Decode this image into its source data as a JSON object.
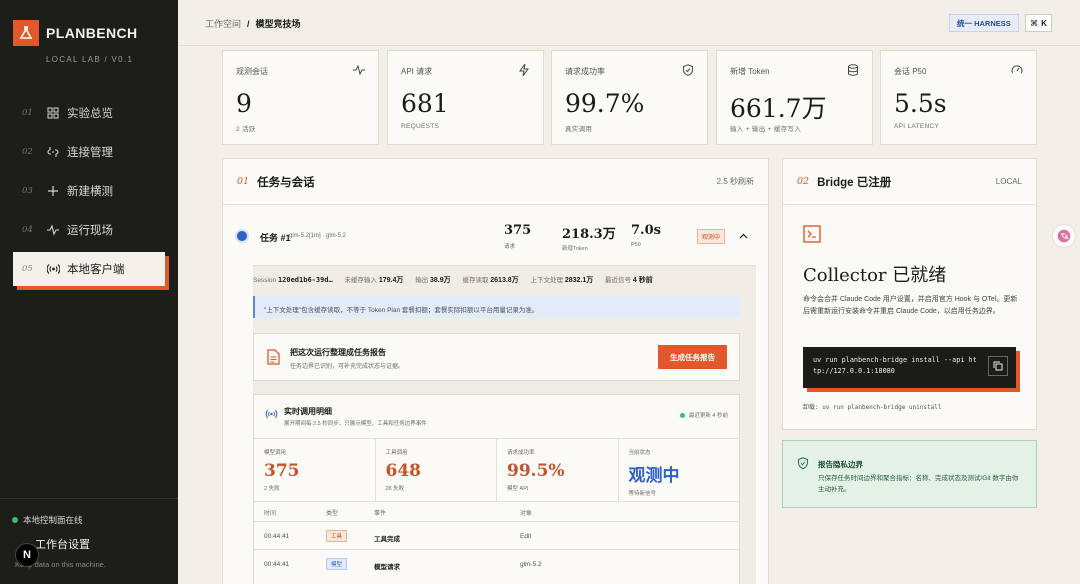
{
  "app": {
    "logo": "PLANBENCH",
    "logo_sub": "LOCAL LAB / V0.1"
  },
  "sidebar": {
    "items": [
      {
        "num": "01",
        "label": "实验总览",
        "icon": "grid-icon"
      },
      {
        "num": "02",
        "label": "连接管理",
        "icon": "plug-icon"
      },
      {
        "num": "03",
        "label": "新建横测",
        "icon": "plus-icon"
      },
      {
        "num": "04",
        "label": "运行现场",
        "icon": "activity-icon"
      },
      {
        "num": "05",
        "label": "本地客户端",
        "icon": "broadcast-icon"
      }
    ],
    "active": 4,
    "status": "本地控制面在线",
    "settings": "工作台设置",
    "settings_note": "Keep data on this machine.",
    "avatar": "N"
  },
  "topbar": {
    "crumb1": "工作空间",
    "sep": "/",
    "crumb2": "模型竞技场",
    "harness": "统一 HARNESS",
    "kbd_key": "K",
    "kbd_mod": "⌘"
  },
  "stats": [
    {
      "label": "观测会话",
      "value": "9",
      "sub": "2 活跃",
      "icon": "pulse-icon"
    },
    {
      "label": "API 请求",
      "value": "681",
      "sub": "REQUESTS",
      "icon": "bolt-icon"
    },
    {
      "label": "请求成功率",
      "value": "99.7%",
      "sub": "真实调用",
      "icon": "shield-icon"
    },
    {
      "label": "新增 Token",
      "value": "661.7万",
      "sub": "输入 + 输出 + 缓存写入",
      "icon": "database-icon"
    },
    {
      "label": "会话 P50",
      "value": "5.5s",
      "sub": "API LATENCY",
      "icon": "gauge-icon"
    }
  ],
  "tasks": {
    "num": "01",
    "title": "任务与会话",
    "refresh": "2.5 秒刷新",
    "task": {
      "name": "任务 #1",
      "model": "glm-5.2[1m] · glm-5.2",
      "requests": "375",
      "requests_label": "请求",
      "tokens": "218.3万",
      "tokens_label": "新增Token",
      "p50": "7.0s",
      "p50_label": "P50",
      "status": "观测中"
    },
    "session": {
      "id_label": "Session",
      "id": "120ed1b6-39d…",
      "in_label": "未缓存输入",
      "in": "179.4万",
      "out_label": "输出",
      "out": "38.9万",
      "cache_label": "缓存读取",
      "cache": "2613.8万",
      "ctx_label": "上下文处理",
      "ctx": "2832.1万",
      "sig_label": "最近信号",
      "sig": "4 秒前"
    },
    "notice": "\"上下文处理\"包含缓存读取，不等于 Token Plan 套餐扣额；套餐实际扣额以平台用量记录为准。",
    "report": {
      "title": "把这次运行整理成任务报告",
      "desc": "任务边界已识别，可补充完成状态与证据。",
      "button": "生成任务报告"
    },
    "live": {
      "title": "实时调用明细",
      "desc": "展开期间每 2.5 秒同步，只展示模型、工具和任务边界事件",
      "updated": "最近更新 4 秒前",
      "metrics": [
        {
          "label": "模型调用",
          "value": "375",
          "sub": "2 失败",
          "color": "#c4522a"
        },
        {
          "label": "工具调用",
          "value": "648",
          "sub": "28 失败",
          "color": "#c4522a"
        },
        {
          "label": "请求成功率",
          "value": "99.5%",
          "sub": "模型 API",
          "color": "#c4522a"
        },
        {
          "label": "当前状态",
          "value": "观测中",
          "sub": "等待新信号",
          "color": "#2f5fc8"
        }
      ],
      "columns": [
        "时间",
        "类型",
        "事件",
        "对象"
      ],
      "rows": [
        {
          "time": "00:44:41",
          "type": "工具",
          "event": "工具完成",
          "object": "Edit"
        },
        {
          "time": "00:44:41",
          "type": "模型",
          "event": "模型请求",
          "object": "glm-5.2"
        }
      ]
    }
  },
  "bridge": {
    "num": "02",
    "title": "Bridge 已注册",
    "right": "LOCAL",
    "heading": "Collector 已就绪",
    "desc": "命令会合并 Claude Code 用户设置，并启用官方 Hook 与 OTel。更新后需重新运行安装命令并重启 Claude Code，以启用任务边界。",
    "cmd": "uv run planbench-bridge install --api http://127.0.0.1:18080",
    "uninstall": "卸载: uv run planbench-bridge uninstall"
  },
  "privacy": {
    "title": "报告隐私边界",
    "desc": "只保存任务时间边界和聚合指标：名称、完成状态及测试/Git 数字由你主动补充。"
  },
  "colors": {
    "accent": "#e2572b",
    "sidebar": "#1d1d1a",
    "background": "#f1efe8"
  }
}
